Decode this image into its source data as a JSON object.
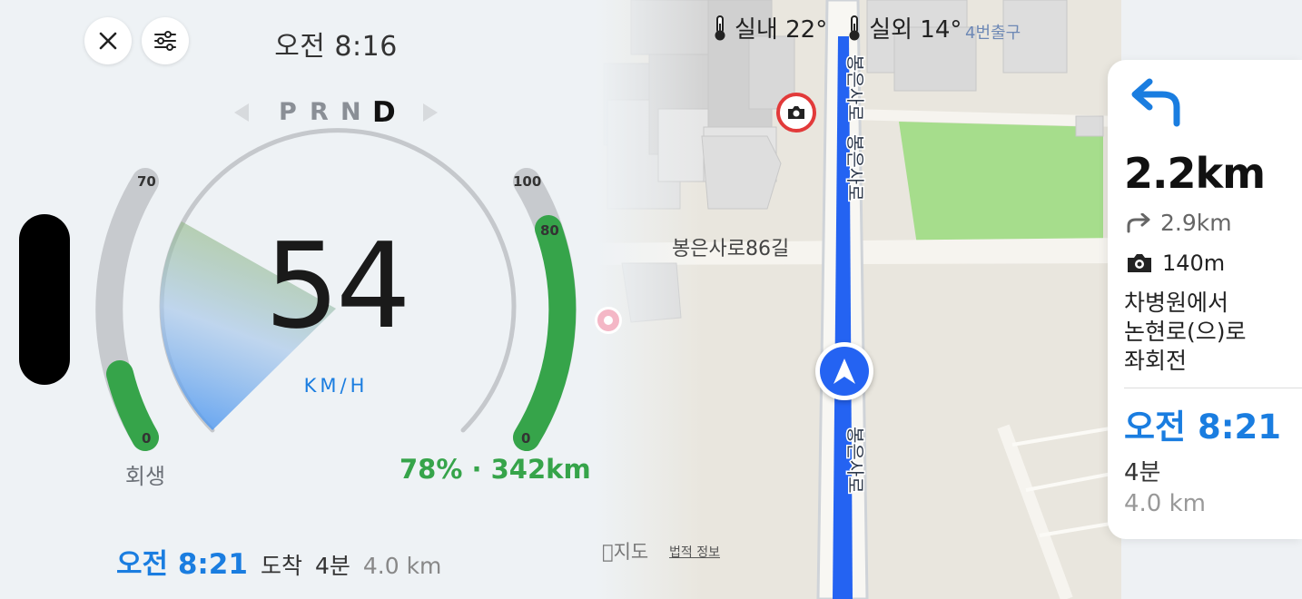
{
  "colors": {
    "accent_blue": "#1a7de0",
    "regen_green": "#36a44a",
    "route_blue": "#2463f2",
    "camera_red": "#e23a3a",
    "park_green": "#a6dd8c"
  },
  "header": {
    "clock": "오전 8:16",
    "close_icon": "close-icon",
    "settings_icon": "sliders-icon"
  },
  "gear": {
    "options": [
      "P",
      "R",
      "N",
      "D"
    ],
    "selected": "D"
  },
  "speed": {
    "value": "54",
    "unit": "KM/H"
  },
  "regen": {
    "label": "회생",
    "scale_max": "70",
    "scale_min": "0",
    "level": 0.27
  },
  "battery": {
    "label": "78% · 342km",
    "scale_max": "100",
    "scale_mark": "80",
    "scale_min": "0",
    "level": 0.78
  },
  "arrival": {
    "time": "오전 8:21",
    "label": "도착",
    "duration": "4분",
    "distance": "4.0 km"
  },
  "map": {
    "indoor_temp": "실내 22°",
    "outdoor_temp": "실외 14°",
    "exit_label": "4번출구",
    "road_main": "봉은사로",
    "road_side": "봉은사로86길",
    "attribution": "지도",
    "legal": "법적 정보"
  },
  "maneuver": {
    "distance": "2.2km",
    "next_distance": "2.9km",
    "camera_distance": "140m",
    "instruction_lines": [
      "차병원에서",
      "논현로(으)로",
      "좌회전"
    ],
    "eta": "오전 8:21",
    "duration": "4분",
    "total_distance": "4.0 km"
  }
}
